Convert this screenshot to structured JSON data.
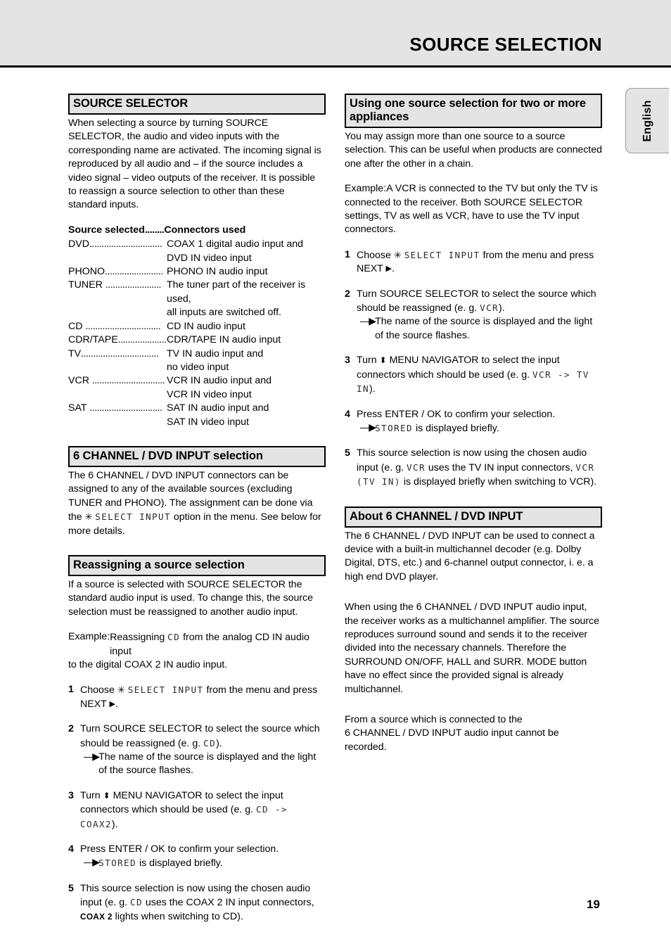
{
  "header": {
    "title": "SOURCE SELECTION"
  },
  "language_tab": {
    "label": "English"
  },
  "page_number": "19",
  "left_column": {
    "source_selector": {
      "heading": "SOURCE SELECTOR",
      "intro": "When selecting a source by turning SOURCE SELECTOR, the audio and video inputs with the corresponding name are activated. The incoming signal is reproduced by all audio and – if the source includes a video signal – video outputs of the receiver. It is possible to reassign a source selection to other than these standard inputs.",
      "table_head_source": "Source selected",
      "table_head_dots": "........",
      "table_head_connectors": "Connectors used",
      "rows": [
        {
          "source": "DVD",
          "dots": "..............................",
          "connector": "COAX 1 digital audio input and",
          "connector2": "DVD IN video input"
        },
        {
          "source": "PHONO",
          "dots": "........................",
          "connector": "PHONO IN audio input",
          "connector2": ""
        },
        {
          "source": "TUNER ",
          "dots": ".......................",
          "connector": "The tuner part of the receiver is used,",
          "connector2": "all inputs are switched off."
        },
        {
          "source": "CD ",
          "dots": "...............................",
          "connector": "CD IN audio input",
          "connector2": ""
        },
        {
          "source": "CDR/TAPE",
          "dots": ".....................",
          "connector": "CDR/TAPE IN audio input",
          "connector2": ""
        },
        {
          "source": "TV",
          "dots": "................................",
          "connector": "TV IN audio input and",
          "connector2": "no video input"
        },
        {
          "source": "VCR ",
          "dots": "..............................",
          "connector": "VCR IN audio input and",
          "connector2": "VCR IN video input"
        },
        {
          "source": "SAT ",
          "dots": "..............................",
          "connector": "SAT IN audio input and",
          "connector2": "SAT IN video input"
        }
      ]
    },
    "six_channel": {
      "heading_bold": "6 CHANNEL / DVD INPUT",
      "heading_rest": " selection",
      "para_a": "The 6 CHANNEL / DVD INPUT connectors can be assigned to any of the available sources (excluding TUNER and PHONO). The assignment can be done via the ",
      "lcd_select_input": "SELECT INPUT",
      "para_b": " option in the menu. See below for more details."
    },
    "reassigning": {
      "heading": "Reassigning a source selection",
      "intro": "If a source is selected with SOURCE SELECTOR the standard audio input is used. To change this, the source selection must be reassigned to another audio input.",
      "example_label": "Example:",
      "example_a": " Reassigning ",
      "example_lcd": "CD",
      "example_b": " from the analog CD IN audio input",
      "example_cont": "to the digital COAX 2 IN audio input.",
      "steps": [
        {
          "num": "1",
          "text_a": "Choose ",
          "lcd": "SELECT INPUT",
          "text_b": " from the menu and press NEXT ",
          "text_c": ".",
          "sub": ""
        },
        {
          "num": "2",
          "text_a": "Turn SOURCE SELECTOR to select the source which should be reassigned (e. g. ",
          "lcd": "CD",
          "text_b": ").",
          "sub": "The name of the source is displayed and the light of the source flashes."
        },
        {
          "num": "3",
          "text_a": "Turn ",
          "text_mid": " MENU NAVIGATOR to select the input connectors which should be used (e. g. ",
          "lcd": "CD -> COAX2",
          "text_b": ").",
          "sub": ""
        },
        {
          "num": "4",
          "text_a": "Press ENTER / OK to confirm your selection.",
          "sub_lcd": "STORED",
          "sub_after": " is displayed briefly."
        },
        {
          "num": "5",
          "text_a": "This source selection is now using the chosen audio input (e. g. ",
          "lcd": "CD",
          "text_b": " uses the COAX 2 IN input connectors, ",
          "smallcaps": "COAX 2",
          "text_c": " lights when switching to CD)."
        }
      ]
    }
  },
  "right_column": {
    "using_one_source": {
      "heading": "Using one source selection for two or more appliances",
      "intro": "You may assign more than one source to a source selection. This can be useful when products are connected one after the other in a chain.",
      "example_label": "Example:",
      "example_a": " A VCR is connected to the TV but only the TV is",
      "example_cont": "connected to the receiver. Both SOURCE SELECTOR settings, TV as well as VCR, have to use the TV input connectors.",
      "steps": [
        {
          "num": "1",
          "text_a": "Choose ",
          "lcd": "SELECT INPUT",
          "text_b": " from the menu and press NEXT ",
          "text_c": "."
        },
        {
          "num": "2",
          "text_a": "Turn SOURCE SELECTOR to select the source which should be reassigned (e. g. ",
          "lcd": "VCR",
          "text_b": ").",
          "sub": "The name of the source is displayed and the light of the source flashes."
        },
        {
          "num": "3",
          "text_a": "Turn ",
          "text_mid": " MENU NAVIGATOR to select the input connectors which should be used (e. g. ",
          "lcd": "VCR -> TV IN",
          "text_b": ")."
        },
        {
          "num": "4",
          "text_a": "Press ENTER / OK to confirm your selection.",
          "sub_lcd": "STORED",
          "sub_after": " is displayed briefly."
        },
        {
          "num": "5",
          "text_a": "This source selection is now using the chosen audio input (e. g. ",
          "lcd": "VCR",
          "text_b": " uses the TV IN input connectors, ",
          "lcd2": "VCR (TV IN)",
          "text_c": " is displayed briefly when switching to VCR)."
        }
      ]
    },
    "about_six_channel": {
      "heading_bold": "About 6 CHANNEL / DVD INPUT",
      "para_1": "The 6 CHANNEL / DVD INPUT can be used to connect a device with a built-in multichannel decoder (e.g. Dolby Digital, DTS, etc.) and 6-channel output connector, i. e. a high end DVD player.",
      "para_2": "When using the 6 CHANNEL / DVD INPUT audio input, the receiver works as a multichannel amplifier. The source reproduces surround sound and sends it to the receiver divided into the necessary channels. Therefore the SURROUND ON/OFF, HALL and SURR. MODE button have no effect since the provided signal is already multichannel.",
      "para_3a": "From a source which is connected to the",
      "para_3b": "6 CHANNEL / DVD INPUT audio input cannot be recorded."
    }
  },
  "glyphs": {
    "asterisk": "✳",
    "triangle_right": "▶",
    "up_down": "⬍",
    "arrow_bullet": "—▶"
  }
}
